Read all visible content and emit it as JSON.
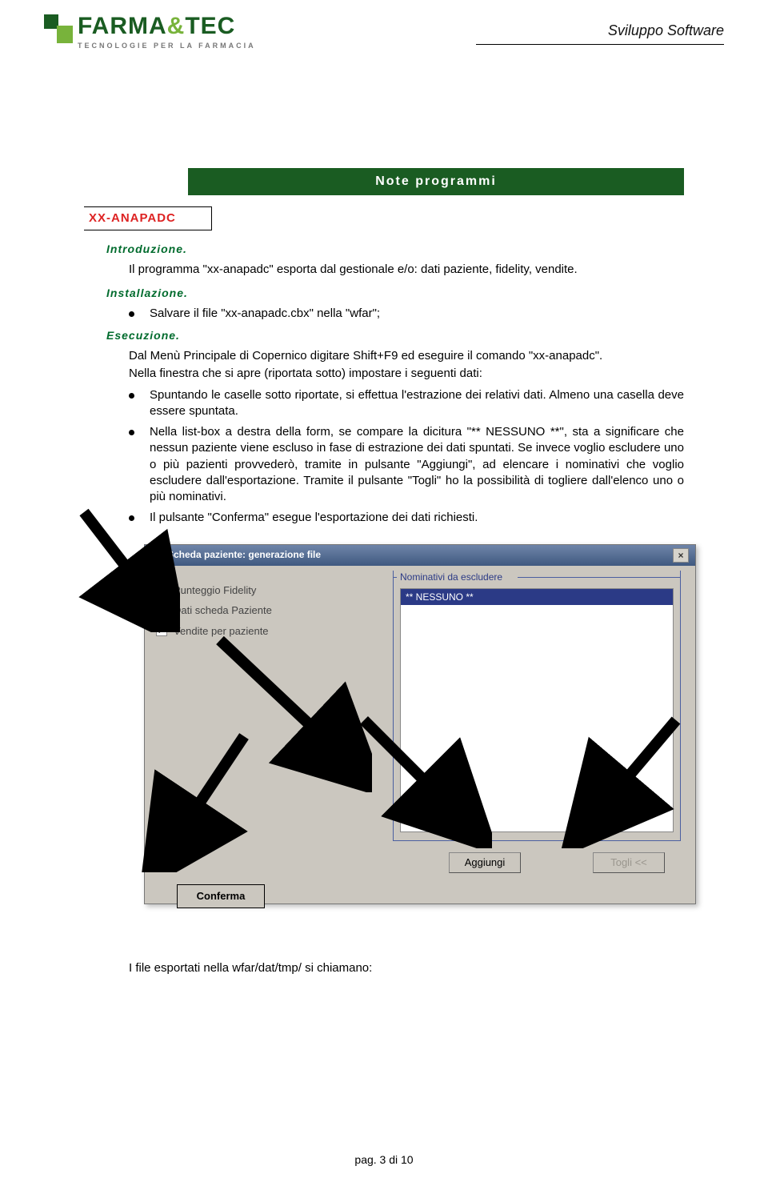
{
  "header": {
    "brand_left": "FARMA",
    "brand_amp": "&",
    "brand_right": "TEC",
    "tagline": "TECNOLOGIE PER LA FARMACIA",
    "right": "Sviluppo Software"
  },
  "title_band": "Note programmi",
  "section_name": "XX-ANAPADC",
  "headings": {
    "intro": "Introduzione.",
    "install": "Installazione.",
    "exec": "Esecuzione."
  },
  "intro_para": "Il programma \"xx-anapadc\" esporta dal gestionale e/o: dati paziente, fidelity, vendite.",
  "install_item": "Salvare il file \"xx-anapadc.cbx\" nella \"wfar\";",
  "exec_line1": "Dal Menù Principale di Copernico digitare Shift+F9 ed eseguire il comando \"xx-anapadc\".",
  "exec_line2": "Nella finestra che si apre (riportata sotto) impostare i seguenti dati:",
  "exec_bullets": [
    "Spuntando le caselle sotto riportate, si effettua l'estrazione dei relativi dati. Almeno una casella deve essere spuntata.",
    "Nella list-box a destra della form, se compare la dicitura \"** NESSUNO **\", sta a significare che nessun paziente viene escluso in fase di estrazione dei dati spuntati. Se invece voglio escludere uno o più pazienti provvederò, tramite in pulsante \"Aggiungi\", ad elencare i nominativi che voglio escludere dall'esportazione. Tramite il pulsante \"Togli\" ho la possibilità di togliere dall'elenco uno o più nominativi.",
    "Il pulsante \"Conferma\" esegue l'esportazione dei dati richiesti."
  ],
  "screenshot": {
    "title": "Scheda paziente: generazione file",
    "close_glyph": "×",
    "checks": [
      "Punteggio Fidelity",
      "Dati scheda Paziente",
      "Vendite per paziente"
    ],
    "legend": "Nominativi da escludere",
    "list_item": "** NESSUNO **",
    "btn_aggiungi": "Aggiungi",
    "btn_togli": "Togli <<",
    "btn_conferma": "Conferma"
  },
  "footnote": "I file esportati nella wfar/dat/tmp/ si chiamano:",
  "pager": "pag.  3 di 10"
}
